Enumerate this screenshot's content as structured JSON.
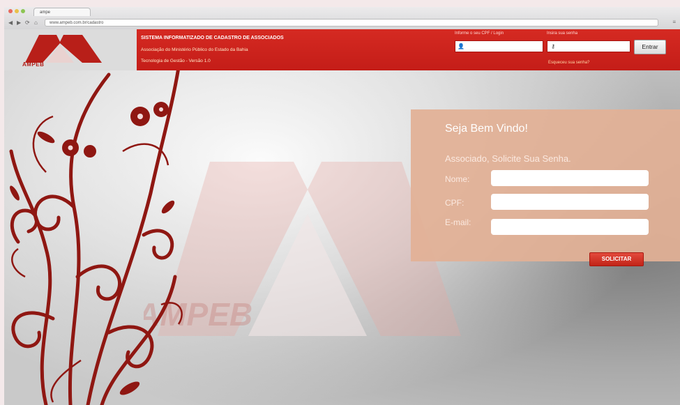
{
  "browser": {
    "tab_title": "ampe",
    "url": "www.ampeb.com.br/cadastro",
    "back": "◀",
    "forward": "▶",
    "reload": "⟳",
    "home": "⌂",
    "menu": "≡"
  },
  "header": {
    "logo_text": "AMPEB",
    "system_title": "SISTEMA INFORMATIZADO DE CADASTRO DE ASSOCIADOS",
    "org_name": "Associação do Ministério Público do Estado da Bahia",
    "version": "Tecnologia de Gestão - Versão 1.0",
    "cpf_label": "Informe o seu CPF / Login",
    "password_label": "Insira sua senha",
    "login_button": "Entrar",
    "forgot_link": "Esqueceu sua senha?"
  },
  "watermark_text": "AMPEB",
  "form": {
    "welcome": "Seja Bem Vindo!",
    "subtitle": "Associado, Solicite Sua Senha.",
    "fields": [
      {
        "label": "Nome:",
        "value": ""
      },
      {
        "label": "CPF:",
        "value": ""
      },
      {
        "label": "E-mail:",
        "value": ""
      }
    ],
    "submit": "SOLICITAR"
  },
  "colors": {
    "header_red": "#c8201a",
    "panel": "#e2b096",
    "floral": "#8f1712"
  }
}
